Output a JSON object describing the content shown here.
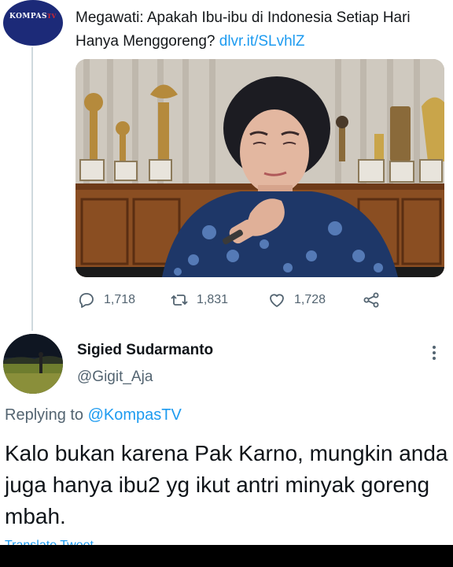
{
  "original_tweet": {
    "account_avatar_logo": "KOMPAS",
    "account_avatar_logo_suffix": "TV",
    "text": "Megawati: Apakah Ibu-ibu di Indonesia Setiap Hari Hanya Menggoreng?",
    "link": "dlvr.it/SLvhlZ",
    "media_icon": "video-thumbnail",
    "actions": {
      "reply_count": "1,718",
      "retweet_count": "1,831",
      "like_count": "1,728",
      "reply_icon": "reply-icon",
      "retweet_icon": "retweet-icon",
      "like_icon": "heart-icon",
      "share_icon": "share-icon"
    }
  },
  "reply_tweet": {
    "display_name": "Sigied Sudarmanto",
    "handle": "@Gigit_Aja",
    "replying_prefix": "Replying to",
    "replying_to": "@KompasTV",
    "text": "Kalo bukan karena Pak Karno, mungkin anda juga hanya ibu2 yg ikut antri minyak goreng mbah.",
    "translate_label": "Translate Tweet"
  },
  "colors": {
    "accent": "#1d9bf0",
    "text_primary": "#0f1419",
    "text_secondary": "#536471",
    "kompas_blue": "#1c2a78"
  }
}
